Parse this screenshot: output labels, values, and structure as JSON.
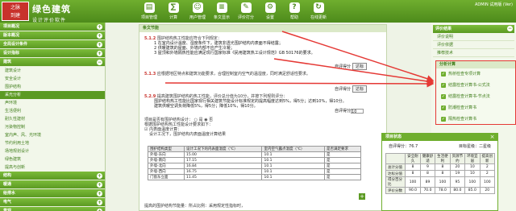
{
  "app": {
    "logo_chars": [
      "之脉",
      "到建"
    ],
    "brand_title": "绿色建筑",
    "brand_subtitle": "设计评价软件",
    "user_info": "ADMIN 试用版 (Ver)"
  },
  "toolbar": [
    {
      "label": "项目管理",
      "icon": "folder-icon"
    },
    {
      "label": "计算",
      "icon": "calculator-icon"
    },
    {
      "label": "用户管理",
      "icon": "user-icon"
    },
    {
      "label": "条文显示",
      "icon": "document-icon"
    },
    {
      "label": "评价打分",
      "icon": "score-icon"
    },
    {
      "label": "设置",
      "icon": "gear-icon"
    },
    {
      "label": "帮助",
      "icon": "help-icon"
    },
    {
      "label": "在线更新",
      "icon": "refresh-icon"
    }
  ],
  "left_sidebar": {
    "sections_top": [
      "项目概况",
      "版本概况",
      "全局设计条件",
      "设计指标"
    ],
    "section_building": "建筑",
    "building_items": [
      "建筑设计",
      "安全设计",
      "围护结构",
      "采光分析",
      "声环境",
      "生活便利",
      "耐久性建材",
      "污染物控制",
      "室内声、风、光环境",
      "节约利用土地",
      "场地规划设计",
      "绿色建筑",
      "提高与创新"
    ],
    "active_index": 3,
    "sections_bottom": [
      "结构",
      "暖通",
      "给排水",
      "电气",
      "景观"
    ]
  },
  "main": {
    "header": "条文节能",
    "clause1": {
      "number": "5.1.2",
      "text": "围护结构热工性能应符合下列规定：",
      "subs": [
        "1 在室内设计温度、湿度条件下，建筑非透光围护结构内表面不得结露；",
        "2 供暖建筑的屋面、外墙内部不应产生冷凝；",
        "3 屋顶和外墙隔热性能应满足现行国家标准《民用建筑热工设计规范》GB 50176的要求。"
      ],
      "result_label": "自评得分",
      "result_button": "达标"
    },
    "clause2": {
      "number": "5.1.3",
      "text": "应根据地区特点和建筑功能要求，合理控制室内空气的温湿度，同时满足舒适性要求。",
      "result_label": "自评得分",
      "result_button": "达标"
    },
    "clause3": {
      "number": "5.2.9",
      "text": "提高建筑围护结构的热工性能，评价总分值为10分，并按下列规则评分：",
      "subs": [
        "围护结构热工性能比国家现行相关建筑节能设计标准规定的提高幅度达到5%，得5分；达到10%，得10分。",
        "建筑供暖空调负荷降低5%，得5分；降低10%，得10分。"
      ],
      "result_label": "自评得分",
      "result_value": "10"
    },
    "question": "项目是否有围护结构设计：",
    "radio_yes": "是",
    "radio_no": "否",
    "check_label": "内表面温度计算：",
    "note": "根据围护结构热工性能设计要求如下：",
    "table_caption": "设计工况下，围护结构内表面温度计算结果",
    "table_headers": [
      "围护结构类型",
      "设计工况下的内表面温度（℃）",
      "室内空气露点温度（℃）",
      "是否满足要求"
    ],
    "table_rows": [
      [
        "外墙-东向",
        "15.00",
        "10.1",
        "是"
      ],
      [
        "外墙-南向",
        "17.15",
        "10.1",
        "是"
      ],
      [
        "外墙-北向",
        "16.84",
        "10.1",
        "是"
      ],
      [
        "外墙-西向",
        "16.75",
        "10.1",
        "是"
      ],
      [
        "门窗东立面",
        "11.45",
        "10.1",
        "是"
      ]
    ],
    "add_button": "+",
    "footer_text": "提高的围护结构节能量：所占比例：采用规定性指标时，"
  },
  "right_sidebar": {
    "sections": [
      "评价结果",
      "评价说明",
      "评价依据",
      "推荐技术"
    ],
    "calc_header": "分析计算",
    "calc_items": [
      "热桥检查专项计算",
      "结露检查计算书-公式法",
      "结露检查计算书-节点法",
      "防潮检查计算书",
      "隔热检查计算书"
    ]
  },
  "status": {
    "title": "项目状态",
    "self_score_label": "自评得分：",
    "self_score_value": "76.7",
    "rating_label": "目标星级：",
    "rating_value": "二星级",
    "col_headers": [
      "",
      "安全耐久",
      "健康舒适",
      "生活便利",
      "资源节约",
      "环境宜居",
      "提高创新"
    ],
    "rows": [
      {
        "label": "总计分值",
        "values": [
          "8",
          "9",
          "8",
          "20",
          "10",
          "2"
        ]
      },
      {
        "label": "达标分值",
        "values": [
          "8",
          "8",
          "8",
          "19",
          "10",
          "2"
        ]
      },
      {
        "label": "得分百分比",
        "values": [
          "100",
          "89",
          "100",
          "95",
          "100",
          "100"
        ]
      },
      {
        "label": "评价分数",
        "values": [
          "90.0",
          "70.0",
          "78.0",
          "80.0",
          "85.0",
          "20"
        ]
      }
    ]
  },
  "colors": {
    "brand_green": "#5b9a22",
    "logo_red": "#c8322c",
    "annotation_red": "#e53935"
  }
}
